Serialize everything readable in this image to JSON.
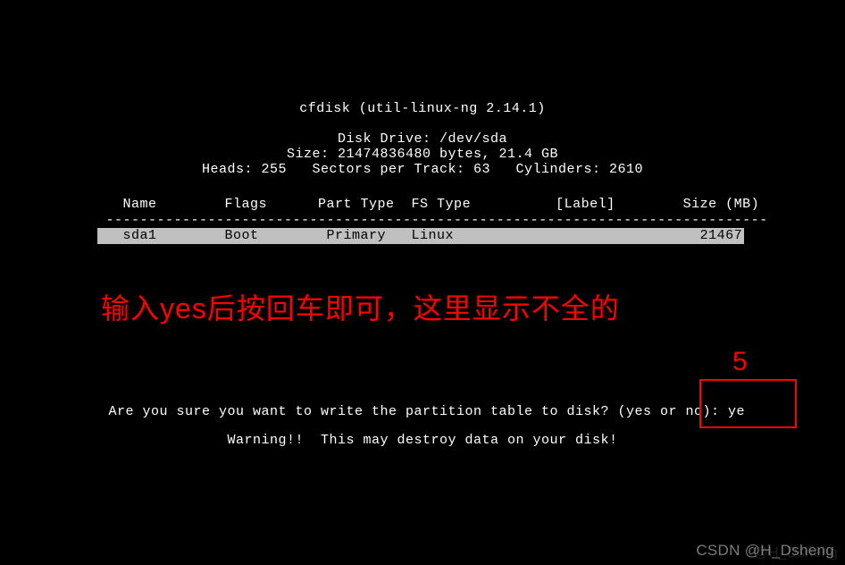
{
  "title_line": "cfdisk (util-linux-ng 2.14.1)",
  "drive_line": "Disk Drive: /dev/sda",
  "size_line": "Size: 21474836480 bytes, 21.4 GB",
  "geom_line": "Heads: 255   Sectors per Track: 63   Cylinders: 2610",
  "columns_row": "   Name        Flags      Part Type  FS Type          [Label]        Size (MB)",
  "dash_row": " ------------------------------------------------------------------------------",
  "partition_row": "   sda1        Boot        Primary   Linux                             21467.99 ",
  "prompt": " Are you sure you want to write the partition table to disk? (yes or no): ye",
  "warning": "Warning!!  This may destroy data on your disk!",
  "annotation_text": "输入yes后按回车即可，这里显示不全的",
  "annotation_num": "5",
  "watermark": "CSDN @H_Dsheng",
  "watermark_bg": "@H_Dsheng"
}
